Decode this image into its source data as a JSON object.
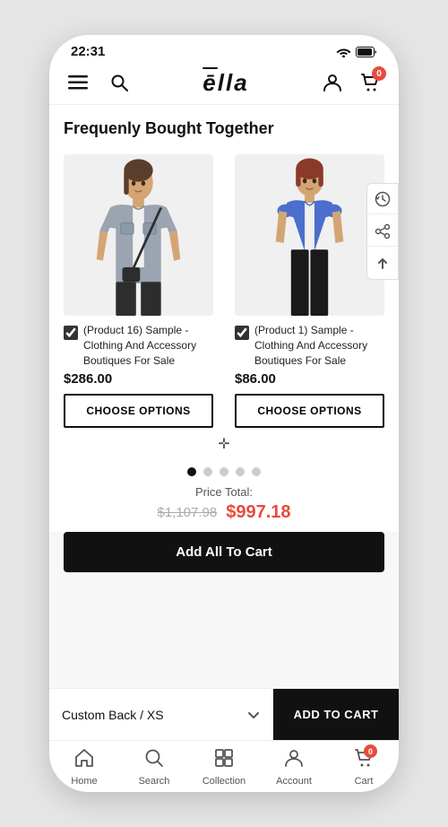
{
  "status": {
    "time": "22:31"
  },
  "header": {
    "logo": "ella",
    "cart_count": "0"
  },
  "section": {
    "title": "Frequenly Bought Together"
  },
  "products": [
    {
      "id": "product-16",
      "name": "(Product 16) Sample - Clothing And Accessory Boutiques For Sale",
      "price": "$286.00",
      "checked": true,
      "choose_label": "CHOOSE OPTIONS"
    },
    {
      "id": "product-1",
      "name": "(Product 1) Sample - Clothing And Accessory Boutiques For Sale",
      "price": "$86.00",
      "checked": true,
      "choose_label": "CHOOSE OPTIONS"
    }
  ],
  "price_total": {
    "label": "Price Total:",
    "original": "$1,107.98",
    "discounted": "$997.18"
  },
  "add_all_label": "Add All To Cart",
  "custom_back": {
    "label": "Custom Back / XS"
  },
  "add_to_cart_label": "ADD TO CART",
  "bottom_nav": [
    {
      "label": "Home",
      "icon": "home"
    },
    {
      "label": "Search",
      "icon": "search"
    },
    {
      "label": "Collection",
      "icon": "grid"
    },
    {
      "label": "Account",
      "icon": "account"
    },
    {
      "label": "Cart",
      "icon": "cart",
      "badge": "0"
    }
  ]
}
